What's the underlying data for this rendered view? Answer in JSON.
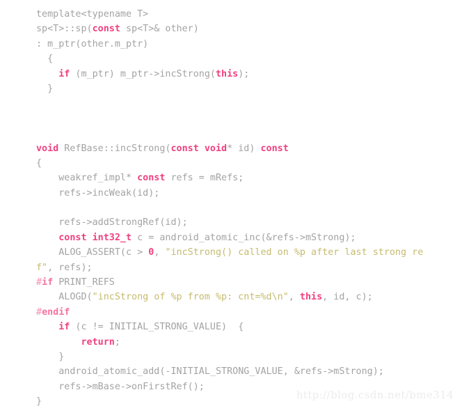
{
  "page": {
    "background_color": "#ffffff",
    "language": "cpp",
    "title": "RefBase incStrong source listing"
  },
  "theme": {
    "plain_color": "#a3a3a3",
    "keyword_color": "#f0407f",
    "preprocessor_color": "#f7739f",
    "preprocessor_hash_color": "#f9a6c3",
    "string_color": "#c5bb6e",
    "number_color": "#f0407f",
    "watermark_color": "#ececec"
  },
  "watermark": {
    "text": "http://blog.csdn.net/bme314"
  },
  "code": {
    "lines": [
      {
        "index": 0,
        "tokens": [
          {
            "t": "plain",
            "s": "template<typename T>"
          }
        ]
      },
      {
        "index": 1,
        "tokens": [
          {
            "t": "plain",
            "s": "sp<T>::sp("
          },
          {
            "t": "kw",
            "s": "const"
          },
          {
            "t": "plain",
            "s": " sp<T>& other)"
          }
        ]
      },
      {
        "index": 2,
        "tokens": [
          {
            "t": "plain",
            "s": ": m_ptr(other.m_ptr)"
          }
        ]
      },
      {
        "index": 3,
        "tokens": [
          {
            "t": "plain",
            "s": "  {"
          }
        ]
      },
      {
        "index": 4,
        "tokens": [
          {
            "t": "plain",
            "s": "    "
          },
          {
            "t": "kw",
            "s": "if"
          },
          {
            "t": "plain",
            "s": " (m_ptr) m_ptr->incStrong("
          },
          {
            "t": "kw",
            "s": "this"
          },
          {
            "t": "plain",
            "s": ");"
          }
        ]
      },
      {
        "index": 5,
        "tokens": [
          {
            "t": "plain",
            "s": "  }"
          }
        ]
      },
      {
        "index": 6,
        "tokens": [
          {
            "t": "plain",
            "s": ""
          }
        ]
      },
      {
        "index": 7,
        "tokens": [
          {
            "t": "plain",
            "s": ""
          }
        ]
      },
      {
        "index": 8,
        "tokens": [
          {
            "t": "plain",
            "s": ""
          }
        ]
      },
      {
        "index": 9,
        "tokens": [
          {
            "t": "kw",
            "s": "void"
          },
          {
            "t": "plain",
            "s": " RefBase::incStrong("
          },
          {
            "t": "kw",
            "s": "const void"
          },
          {
            "t": "plain",
            "s": "* id) "
          },
          {
            "t": "kw",
            "s": "const"
          }
        ]
      },
      {
        "index": 10,
        "tokens": [
          {
            "t": "plain",
            "s": "{"
          }
        ]
      },
      {
        "index": 11,
        "tokens": [
          {
            "t": "plain",
            "s": "    weakref_impl* "
          },
          {
            "t": "kw",
            "s": "const"
          },
          {
            "t": "plain",
            "s": " refs = mRefs;"
          }
        ]
      },
      {
        "index": 12,
        "tokens": [
          {
            "t": "plain",
            "s": "    refs->incWeak(id);"
          }
        ]
      },
      {
        "index": 13,
        "tokens": [
          {
            "t": "plain",
            "s": ""
          }
        ]
      },
      {
        "index": 14,
        "tokens": [
          {
            "t": "plain",
            "s": "    refs->addStrongRef(id);"
          }
        ]
      },
      {
        "index": 15,
        "tokens": [
          {
            "t": "plain",
            "s": "    "
          },
          {
            "t": "kw",
            "s": "const int32_t"
          },
          {
            "t": "plain",
            "s": " c = android_atomic_inc(&refs->mStrong);"
          }
        ]
      },
      {
        "index": 16,
        "tokens": [
          {
            "t": "plain",
            "s": "    ALOG_ASSERT(c > "
          },
          {
            "t": "num",
            "s": "0"
          },
          {
            "t": "plain",
            "s": ", "
          },
          {
            "t": "str",
            "s": "\"incStrong() called on %p after last strong re"
          }
        ]
      },
      {
        "index": 17,
        "tokens": [
          {
            "t": "str",
            "s": "f\""
          },
          {
            "t": "plain",
            "s": ", refs);"
          }
        ]
      },
      {
        "index": 18,
        "tokens": [
          {
            "t": "pphash",
            "s": "#"
          },
          {
            "t": "pp",
            "s": "if"
          },
          {
            "t": "plain",
            "s": " PRINT_REFS"
          }
        ]
      },
      {
        "index": 19,
        "tokens": [
          {
            "t": "plain",
            "s": "    ALOGD("
          },
          {
            "t": "str",
            "s": "\"incStrong of %p from %p: cnt=%d\\n\""
          },
          {
            "t": "plain",
            "s": ", "
          },
          {
            "t": "kw",
            "s": "this"
          },
          {
            "t": "plain",
            "s": ", id, c);"
          }
        ]
      },
      {
        "index": 20,
        "tokens": [
          {
            "t": "pphash",
            "s": "#"
          },
          {
            "t": "pp",
            "s": "endif"
          }
        ]
      },
      {
        "index": 21,
        "tokens": [
          {
            "t": "plain",
            "s": "    "
          },
          {
            "t": "kw",
            "s": "if"
          },
          {
            "t": "plain",
            "s": " (c != INITIAL_STRONG_VALUE)  {"
          }
        ]
      },
      {
        "index": 22,
        "tokens": [
          {
            "t": "plain",
            "s": "        "
          },
          {
            "t": "kw",
            "s": "return"
          },
          {
            "t": "plain",
            "s": ";"
          }
        ]
      },
      {
        "index": 23,
        "tokens": [
          {
            "t": "plain",
            "s": "    }"
          }
        ]
      },
      {
        "index": 24,
        "tokens": [
          {
            "t": "plain",
            "s": "    android_atomic_add(-INITIAL_STRONG_VALUE, &refs->mStrong);"
          }
        ]
      },
      {
        "index": 25,
        "tokens": [
          {
            "t": "plain",
            "s": "    refs->mBase->onFirstRef();"
          }
        ]
      },
      {
        "index": 26,
        "tokens": [
          {
            "t": "plain",
            "s": "}"
          }
        ]
      }
    ]
  }
}
